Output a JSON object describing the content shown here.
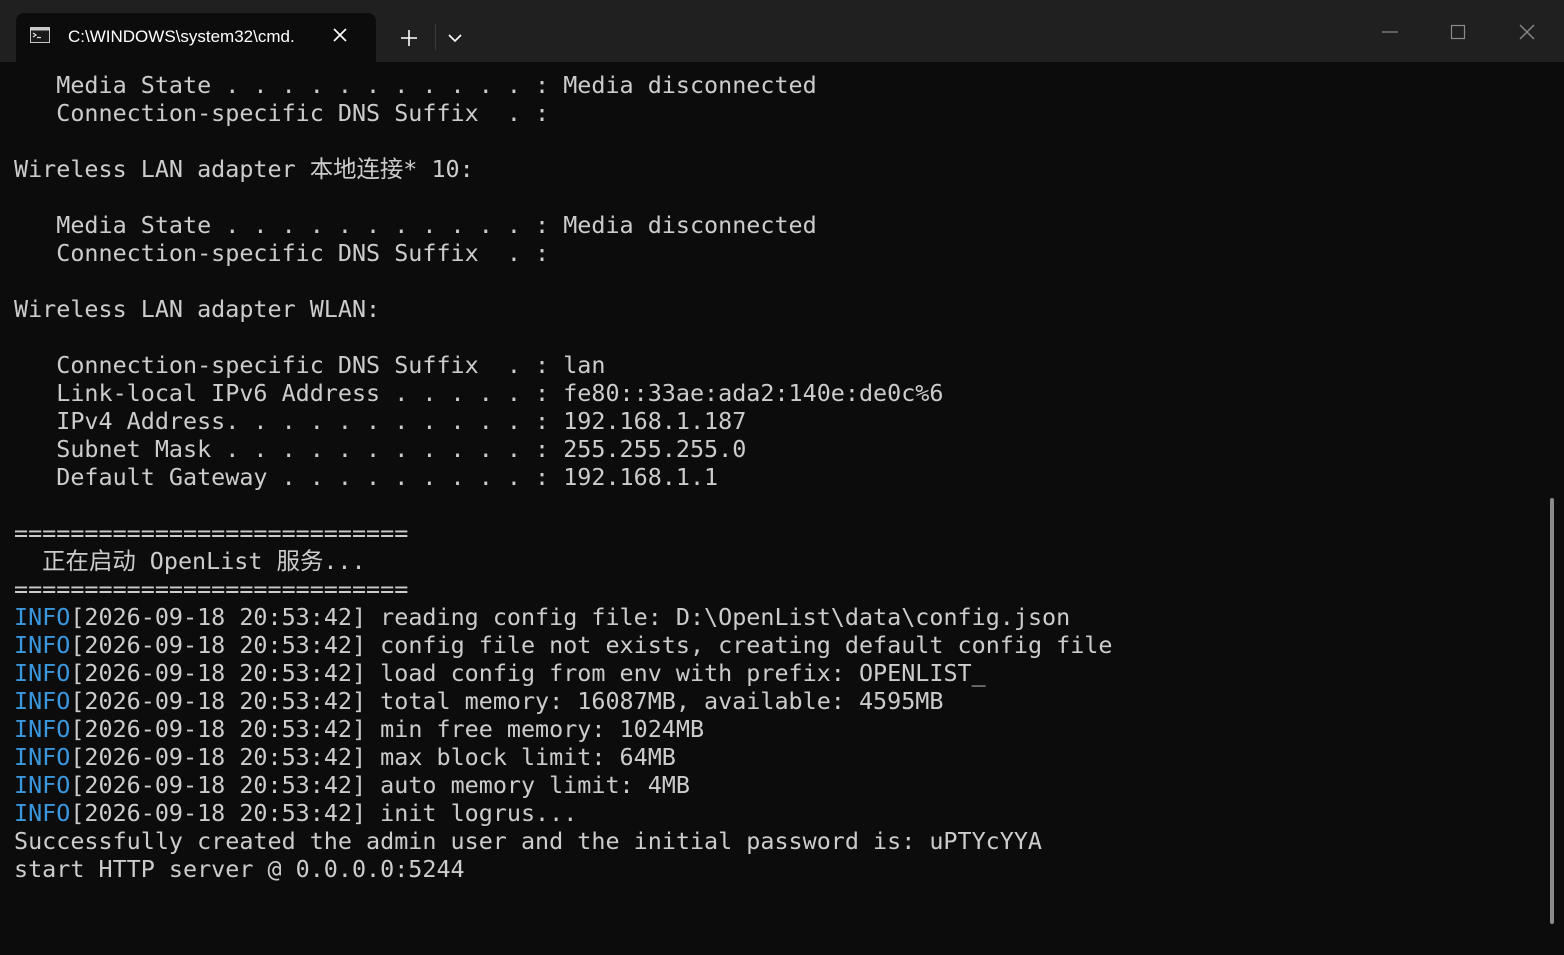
{
  "window": {
    "tab_title": "C:\\WINDOWS\\system32\\cmd.",
    "icons": {
      "tab": "terminal-icon",
      "tab_close": "close-icon",
      "new_tab": "plus-icon",
      "dropdown": "chevron-down-icon",
      "minimize": "minimize-icon",
      "maximize": "maximize-icon",
      "close": "close-icon"
    }
  },
  "colors": {
    "background": "#0c0c0c",
    "titlebar": "#202020",
    "text": "#cccccc",
    "info": "#3a96dd"
  },
  "terminal": {
    "lines": [
      {
        "text": "   Media State . . . . . . . . . . . : Media disconnected"
      },
      {
        "text": "   Connection-specific DNS Suffix  . :"
      },
      {
        "text": ""
      },
      {
        "text": "Wireless LAN adapter 本地连接* 10:"
      },
      {
        "text": ""
      },
      {
        "text": "   Media State . . . . . . . . . . . : Media disconnected"
      },
      {
        "text": "   Connection-specific DNS Suffix  . :"
      },
      {
        "text": ""
      },
      {
        "text": "Wireless LAN adapter WLAN:"
      },
      {
        "text": ""
      },
      {
        "text": "   Connection-specific DNS Suffix  . : lan"
      },
      {
        "text": "   Link-local IPv6 Address . . . . . : fe80::33ae:ada2:140e:de0c%6"
      },
      {
        "text": "   IPv4 Address. . . . . . . . . . . : 192.168.1.187"
      },
      {
        "text": "   Subnet Mask . . . . . . . . . . . : 255.255.255.0"
      },
      {
        "text": "   Default Gateway . . . . . . . . . : 192.168.1.1"
      },
      {
        "text": ""
      },
      {
        "text": "============================"
      },
      {
        "text": "  正在启动 OpenList 服务..."
      },
      {
        "text": "============================"
      },
      {
        "tag": "INFO",
        "text": "[2026-09-18 20:53:42] reading config file: D:\\OpenList\\data\\config.json"
      },
      {
        "tag": "INFO",
        "text": "[2026-09-18 20:53:42] config file not exists, creating default config file"
      },
      {
        "tag": "INFO",
        "text": "[2026-09-18 20:53:42] load config from env with prefix: OPENLIST_"
      },
      {
        "tag": "INFO",
        "text": "[2026-09-18 20:53:42] total memory: 16087MB, available: 4595MB"
      },
      {
        "tag": "INFO",
        "text": "[2026-09-18 20:53:42] min free memory: 1024MB"
      },
      {
        "tag": "INFO",
        "text": "[2026-09-18 20:53:42] max block limit: 64MB"
      },
      {
        "tag": "INFO",
        "text": "[2026-09-18 20:53:42] auto memory limit: 4MB"
      },
      {
        "tag": "INFO",
        "text": "[2026-09-18 20:53:42] init logrus..."
      },
      {
        "text": "Successfully created the admin user and the initial password is: uPTYcYYA"
      },
      {
        "text": "start HTTP server @ 0.0.0.0:5244"
      }
    ]
  }
}
